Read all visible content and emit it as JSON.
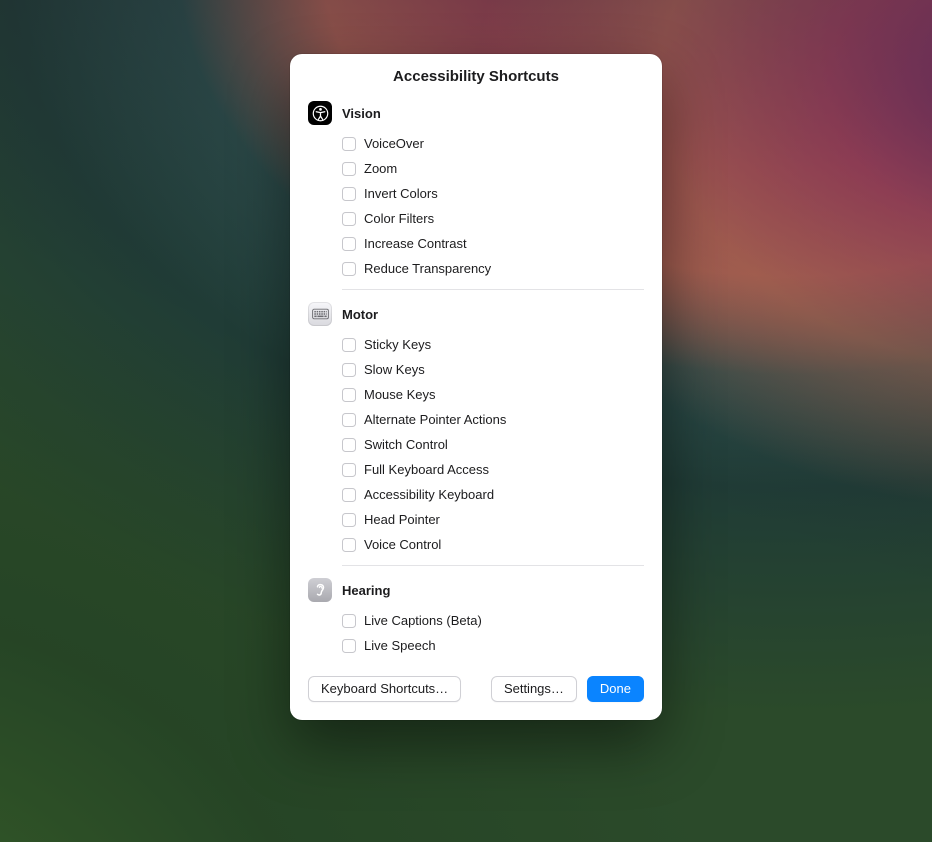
{
  "window": {
    "title": "Accessibility Shortcuts"
  },
  "sections": {
    "vision": {
      "title": "Vision",
      "icon": "accessibility-icon",
      "items": [
        {
          "label": "VoiceOver"
        },
        {
          "label": "Zoom"
        },
        {
          "label": "Invert Colors"
        },
        {
          "label": "Color Filters"
        },
        {
          "label": "Increase Contrast"
        },
        {
          "label": "Reduce Transparency"
        }
      ]
    },
    "motor": {
      "title": "Motor",
      "icon": "keyboard-icon",
      "items": [
        {
          "label": "Sticky Keys"
        },
        {
          "label": "Slow Keys"
        },
        {
          "label": "Mouse Keys"
        },
        {
          "label": "Alternate Pointer Actions"
        },
        {
          "label": "Switch Control"
        },
        {
          "label": "Full Keyboard Access"
        },
        {
          "label": "Accessibility Keyboard"
        },
        {
          "label": "Head Pointer"
        },
        {
          "label": "Voice Control"
        }
      ]
    },
    "hearing": {
      "title": "Hearing",
      "icon": "ear-icon",
      "items": [
        {
          "label": "Live Captions (Beta)"
        },
        {
          "label": "Live Speech"
        }
      ]
    }
  },
  "footer": {
    "keyboard_shortcuts_label": "Keyboard Shortcuts…",
    "settings_label": "Settings…",
    "done_label": "Done"
  }
}
